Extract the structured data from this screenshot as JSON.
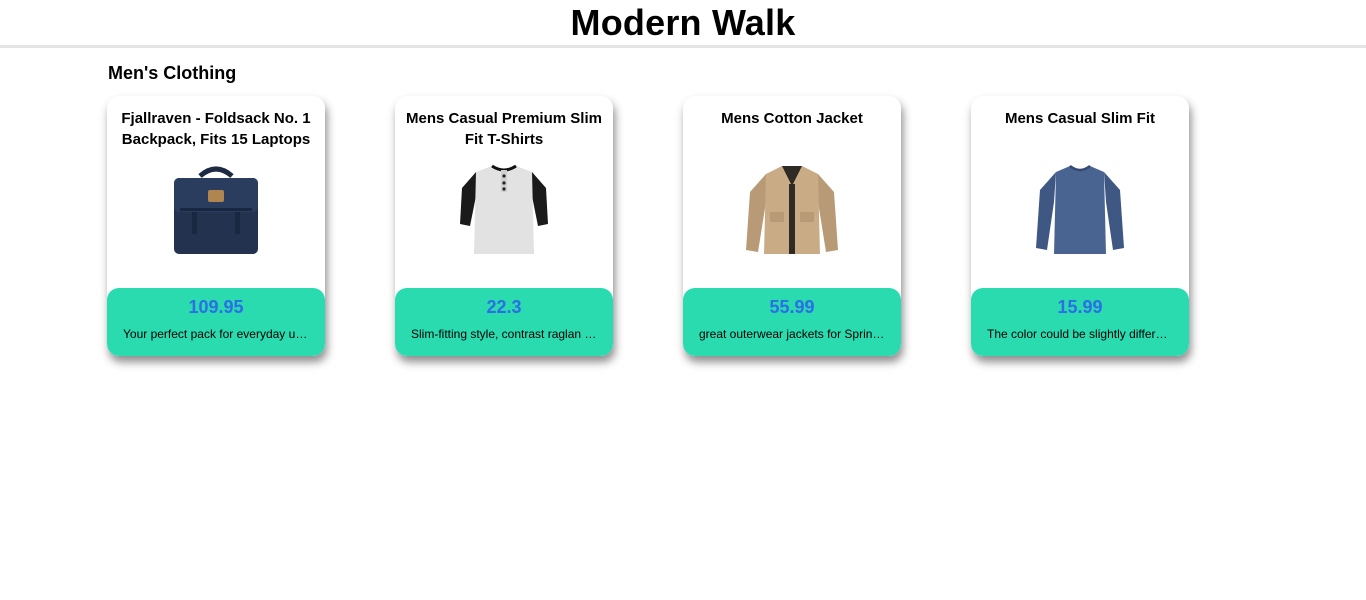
{
  "header": {
    "title": "Modern Walk"
  },
  "section": {
    "title": "Men's Clothing"
  },
  "products": [
    {
      "title": "Fjallraven - Foldsack No. 1 Backpack, Fits 15 Laptops",
      "price": "109.95",
      "description": "Your perfect pack for everyday use and walks in the forest.",
      "image": "backpack-image"
    },
    {
      "title": "Mens Casual Premium Slim Fit T-Shirts",
      "price": "22.3",
      "description": "Slim-fitting style, contrast raglan long sleeve, three-button henley placket.",
      "image": "tshirt-image"
    },
    {
      "title": "Mens Cotton Jacket",
      "price": "55.99",
      "description": "great outerwear jackets for Spring/Autumn/Winter.",
      "image": "jacket-image"
    },
    {
      "title": "Mens Casual Slim Fit",
      "price": "15.99",
      "description": "The color could be slightly different between on the screen and in practice.",
      "image": "long-sleeve-shirt-image"
    }
  ],
  "colors": {
    "accent": "#2adbb0",
    "price": "#2b6ee6",
    "divider": "#e5e5e5"
  }
}
